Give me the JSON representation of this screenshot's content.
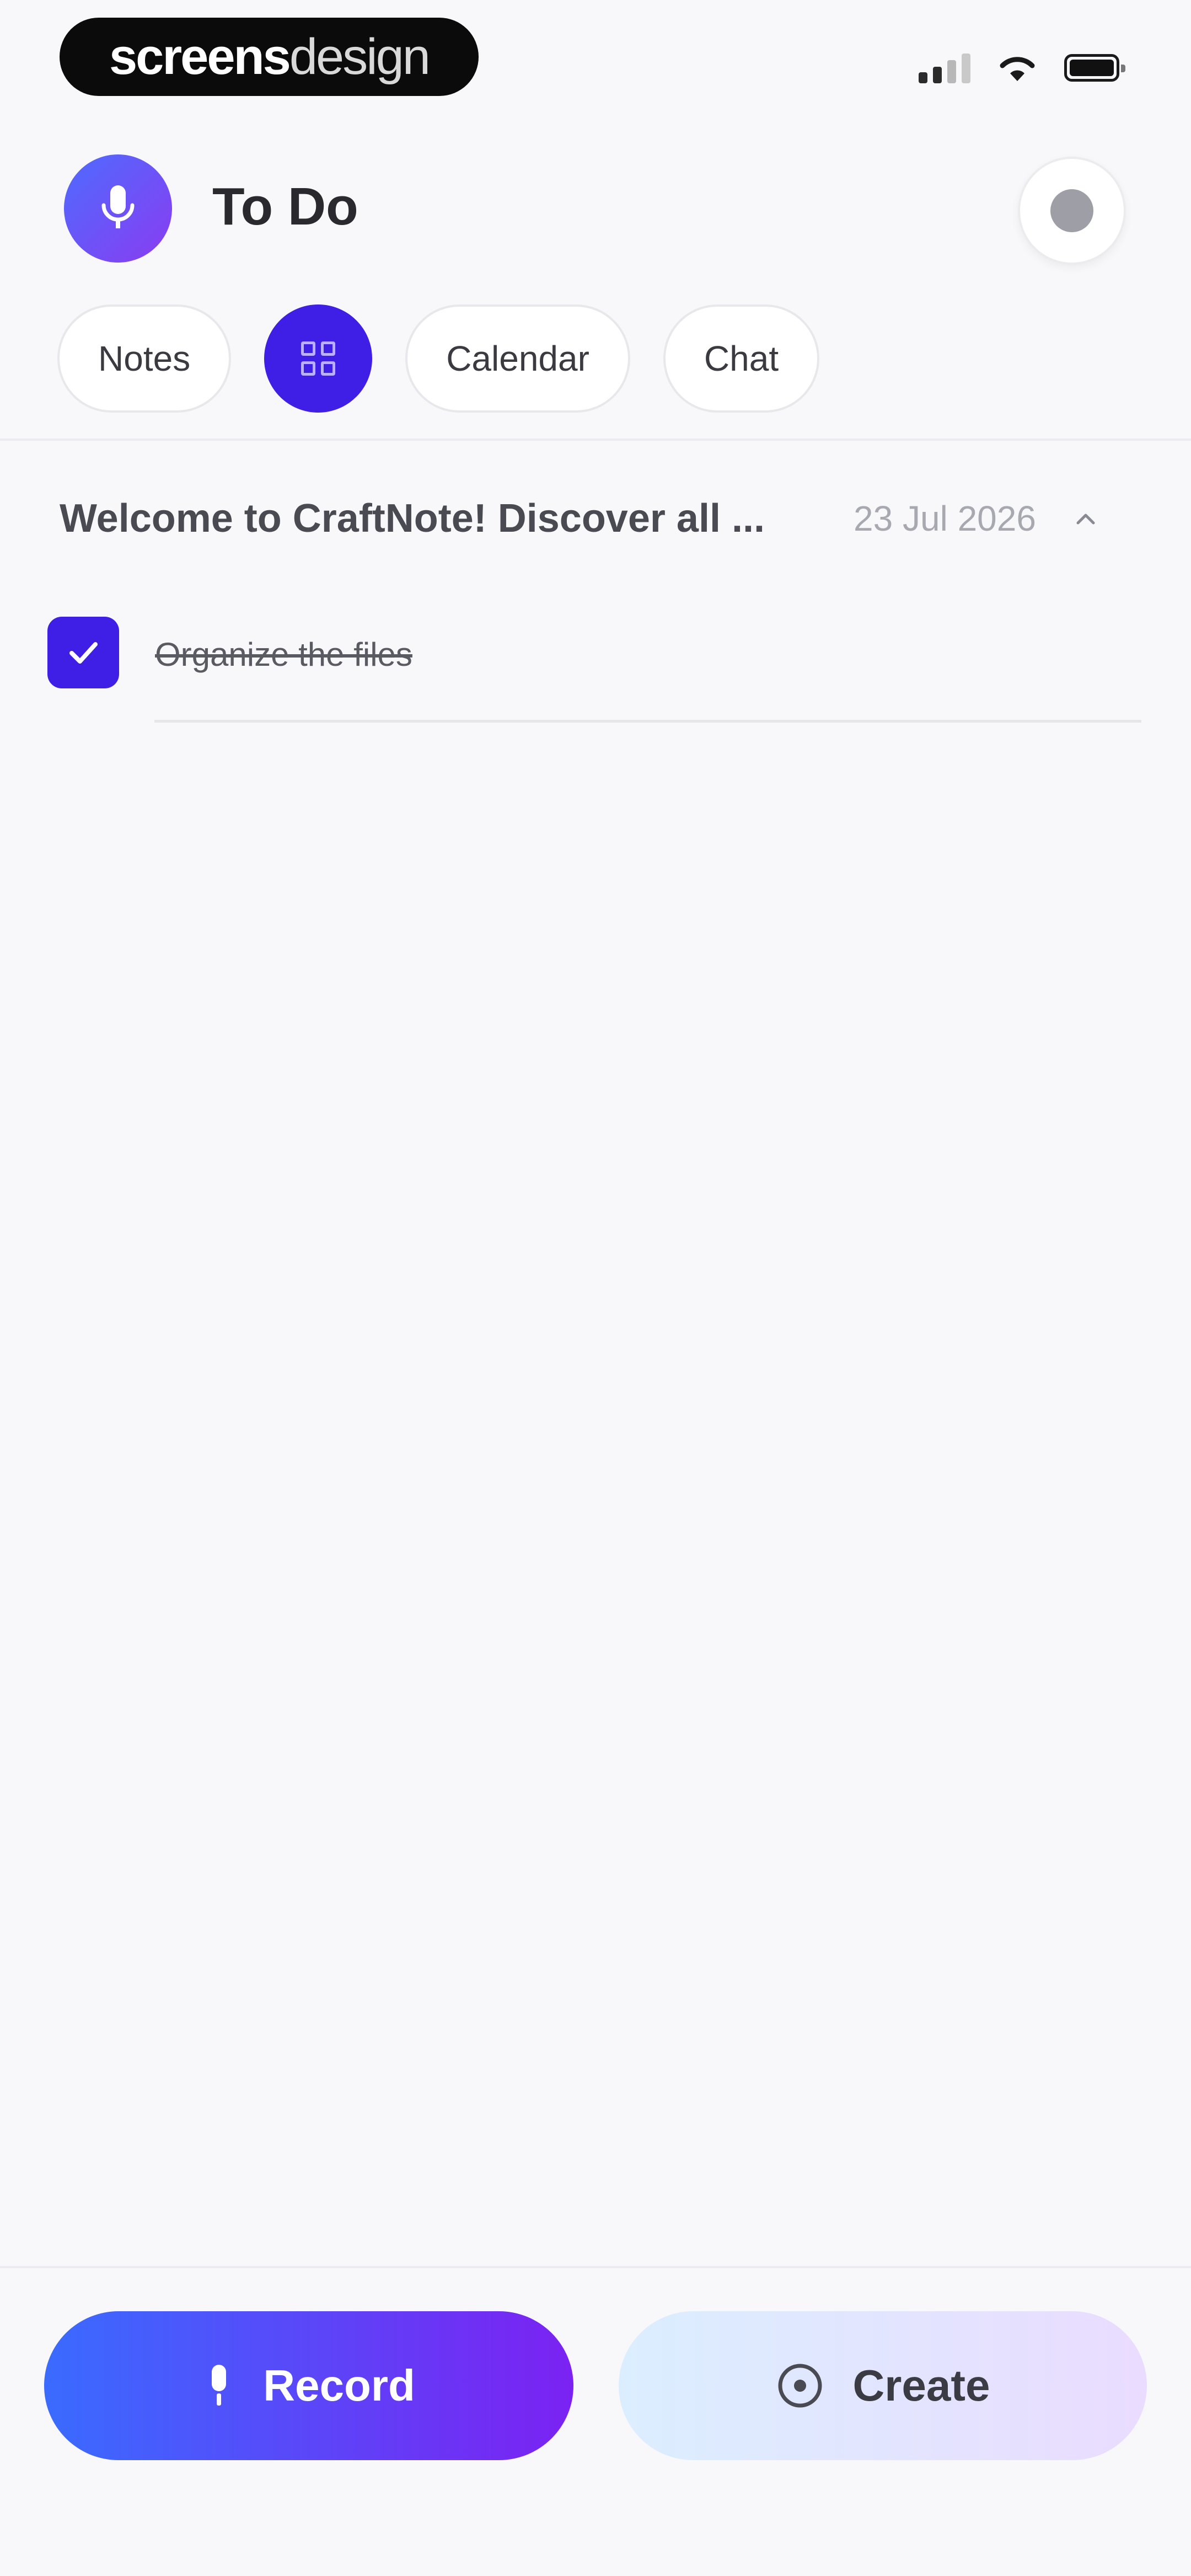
{
  "status_bar": {
    "brand_bold": "screens",
    "brand_light": "design"
  },
  "header": {
    "title": "To Do",
    "avatar_icon": "mic-icon",
    "settings_icon": "settings-dot-icon"
  },
  "tabs": [
    {
      "label": "Notes",
      "active": false
    },
    {
      "label": "",
      "active": true,
      "icon": "grid-icon"
    },
    {
      "label": "Calendar",
      "active": false
    },
    {
      "label": "Chat",
      "active": false
    }
  ],
  "note": {
    "title": "Welcome to CraftNote! Discover all ...",
    "date": "23 Jul 2026",
    "collapse_icon": "chevron-up-icon"
  },
  "todos": [
    {
      "text": "Organize the files",
      "checked": true
    }
  ],
  "actions": {
    "record_label": "Record",
    "record_icon": "mic-icon",
    "create_label": "Create",
    "create_icon": "plus-circle-icon"
  },
  "colors": {
    "accent": "#3f1ee6",
    "record_gradient_start": "#3a6bff",
    "record_gradient_end": "#7b22f2",
    "create_gradient_start": "#dbeeff",
    "create_gradient_end": "#eadcff"
  }
}
